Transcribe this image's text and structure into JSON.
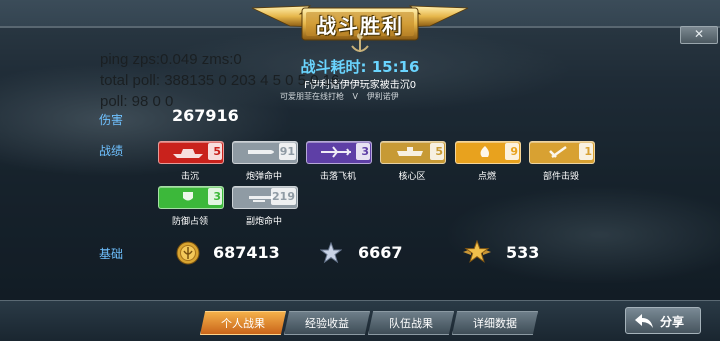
{
  "banner": {
    "title": "战斗胜利"
  },
  "close_icon": "close-icon",
  "battle_time": "战斗耗时: 15:16",
  "players_line": "F伊利诸伊伊玩家被击沉0",
  "sub_line": {
    "left": "可爱朋菲在线打枪",
    "vs": "V",
    "right": "伊利诺伊"
  },
  "debug_lines": [
    "ping zps:0.049 zms:0",
    "total poll: 388135 0 203 4 5 0 5 0 16",
    "poll: 98 0 0"
  ],
  "damage": {
    "label": "伤害",
    "value": "267916"
  },
  "achievements": {
    "label": "战绩",
    "items": [
      {
        "caption": "击沉",
        "count": "5",
        "color": "#c9221c",
        "icon": "ship-icon"
      },
      {
        "caption": "炮弹命中",
        "count": "91",
        "color": "#8e9aa3",
        "icon": "shell-icon"
      },
      {
        "caption": "击落飞机",
        "count": "3",
        "color": "#5e3fa6",
        "icon": "plane-icon"
      },
      {
        "caption": "核心区",
        "count": "5",
        "color": "#c79a35",
        "icon": "core-icon"
      },
      {
        "caption": "点燃",
        "count": "9",
        "color": "#e8a21e",
        "icon": "fire-icon"
      },
      {
        "caption": "部件击毁",
        "count": "1",
        "color": "#d8a132",
        "icon": "part-icon"
      },
      {
        "caption": "防御占领",
        "count": "3",
        "color": "#3cb83a",
        "icon": "defend-icon"
      },
      {
        "caption": "副炮命中",
        "count": "219",
        "color": "#8f9ba4",
        "icon": "secondary-gun-icon"
      }
    ]
  },
  "basic": {
    "label": "基础",
    "coins": {
      "icon": "coin-icon",
      "value": "687413"
    },
    "exp": {
      "icon": "silver-star-icon",
      "value": "6667"
    },
    "rank": {
      "icon": "gold-star-icon",
      "value": "533"
    }
  },
  "tabs": [
    {
      "label": "个人战果",
      "active": true
    },
    {
      "label": "经验收益",
      "active": false
    },
    {
      "label": "队伍战果",
      "active": false
    },
    {
      "label": "详细数据",
      "active": false
    }
  ],
  "share": {
    "label": "分享",
    "icon": "share-arrow-icon"
  }
}
